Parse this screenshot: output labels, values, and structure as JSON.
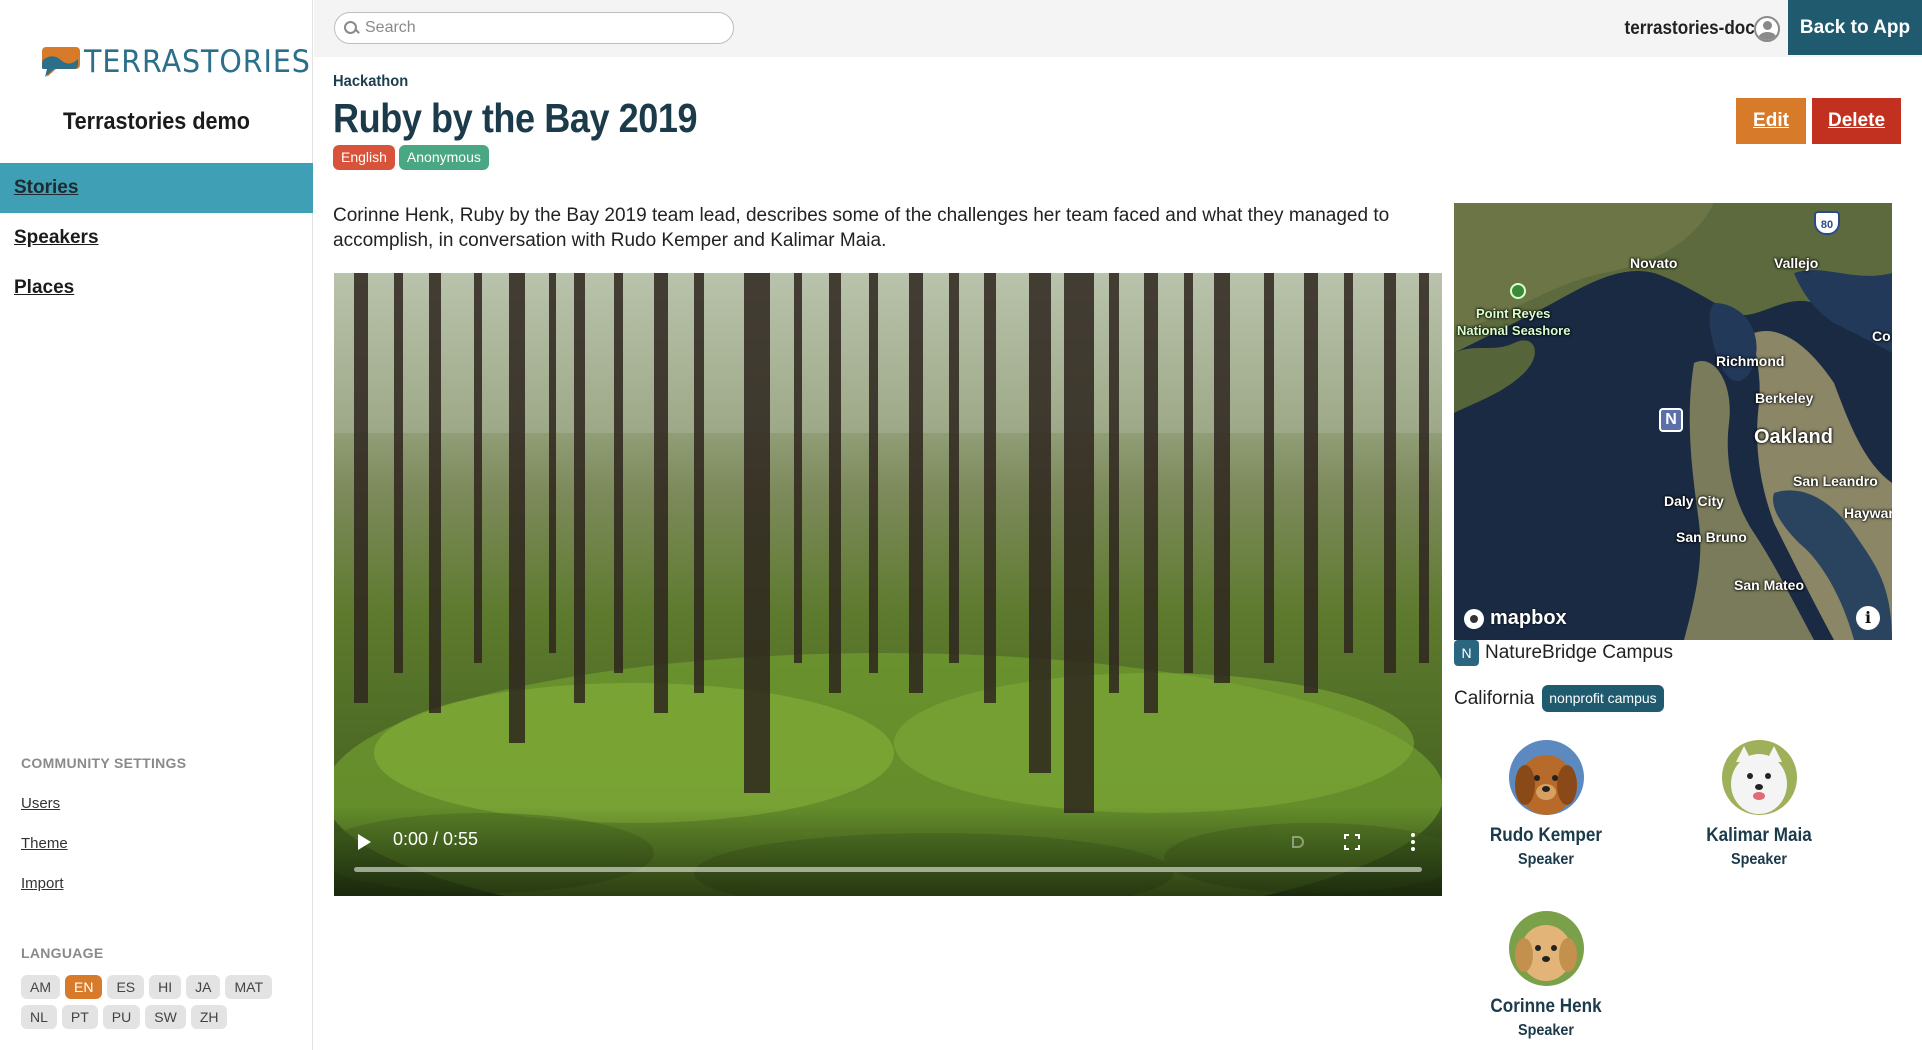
{
  "brand": {
    "logo_text": "TERRASTORIES",
    "community_name": "Terrastories demo"
  },
  "sidebar": {
    "nav": [
      {
        "label": "Stories",
        "active": true
      },
      {
        "label": "Speakers",
        "active": false
      },
      {
        "label": "Places",
        "active": false
      }
    ],
    "community_settings_label": "COMMUNITY SETTINGS",
    "settings_links": [
      "Users",
      "Theme",
      "Import"
    ],
    "language_label": "LANGUAGE",
    "languages": [
      "AM",
      "EN",
      "ES",
      "HI",
      "JA",
      "MAT",
      "NL",
      "PT",
      "PU",
      "SW",
      "ZH"
    ],
    "active_language": "EN"
  },
  "topbar": {
    "search_placeholder": "Search",
    "user_name": "terrastories-docs",
    "back_button": "Back to App"
  },
  "story": {
    "topic": "Hackathon",
    "title": "Ruby by the Bay 2019",
    "badges": [
      {
        "label": "English",
        "color": "#d9533a"
      },
      {
        "label": "Anonymous",
        "color": "#4aa784"
      }
    ],
    "edit_label": "Edit",
    "delete_label": "Delete",
    "description": "Corinne Henk, Ruby by the Bay 2019 team lead, describes some of the challenges her team faced and what they managed to accomplish, in conversation with Rudo Kemper and Kalimar Maia.",
    "video": {
      "time": "0:00 / 0:55",
      "progress": 0
    }
  },
  "map": {
    "labels": [
      {
        "text": "Novato",
        "style": "small"
      },
      {
        "text": "Vallejo",
        "style": "small"
      },
      {
        "text": "Point Reyes",
        "style": "green"
      },
      {
        "text": "National Seashore",
        "style": "green"
      },
      {
        "text": "Richmond",
        "style": "small"
      },
      {
        "text": "Berkeley",
        "style": "small"
      },
      {
        "text": "Oakland",
        "style": "big"
      },
      {
        "text": "San Leandro",
        "style": "small"
      },
      {
        "text": "Hayward",
        "style": "small"
      },
      {
        "text": "Daly City",
        "style": "small"
      },
      {
        "text": "San Bruno",
        "style": "small"
      },
      {
        "text": "San Mateo",
        "style": "small"
      },
      {
        "text": "Co",
        "style": "small"
      }
    ],
    "interstate": "80",
    "marker_letter": "N",
    "attribution": "mapbox",
    "info": "i"
  },
  "place": {
    "icon_letter": "N",
    "name": "NatureBridge Campus",
    "region": "California",
    "type": "nonprofit campus"
  },
  "speakers": [
    {
      "name": "Rudo Kemper",
      "role": "Speaker"
    },
    {
      "name": "Kalimar Maia",
      "role": "Speaker"
    },
    {
      "name": "Corinne Henk",
      "role": "Speaker"
    }
  ]
}
